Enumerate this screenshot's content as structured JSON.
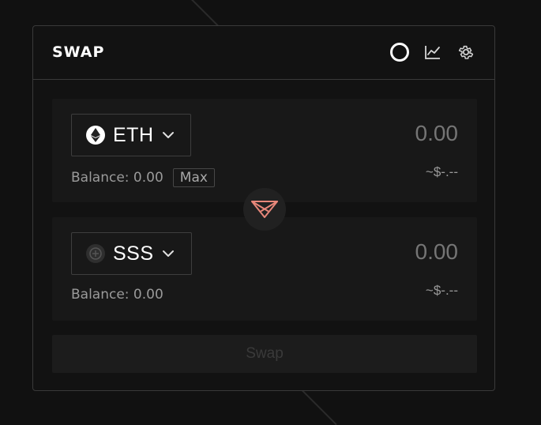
{
  "header": {
    "title": "SWAP",
    "icons": [
      "loading-ring-icon",
      "chart-icon",
      "gear-icon"
    ]
  },
  "from": {
    "token_symbol": "ETH",
    "token_icon": "ethereum-icon",
    "amount_placeholder": "0.00",
    "usd_value": "~$-.--",
    "balance_label": "Balance: 0.00",
    "max_label": "Max"
  },
  "to": {
    "token_symbol": "SSS",
    "token_icon": "sss-token-icon",
    "amount_placeholder": "0.00",
    "usd_value": "~$-.--",
    "balance_label": "Balance: 0.00"
  },
  "swap_direction_icon": "swap-arrow-icon",
  "submit_label": "Swap",
  "colors": {
    "background": "#111111",
    "card": "#121212",
    "panel": "#181818",
    "accent": "#e8877a",
    "muted_text": "#9a9a9a",
    "disabled_text": "#3a3a3a"
  }
}
